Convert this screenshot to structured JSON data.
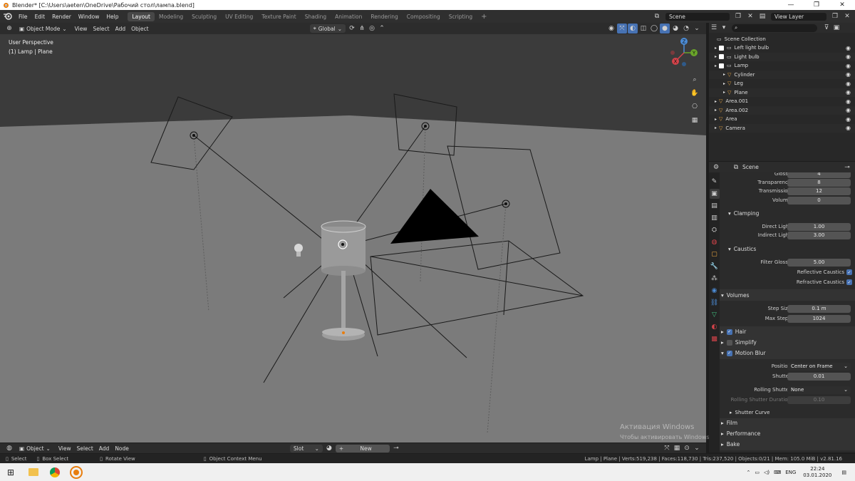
{
  "window": {
    "title": "Blender* [C:\\Users\\aeten\\OneDrive\\Рабочий стол\\лампа.blend]",
    "minimize": "—",
    "maximize": "❐",
    "close": "✕"
  },
  "menu": [
    "File",
    "Edit",
    "Render",
    "Window",
    "Help"
  ],
  "workspaces": [
    {
      "label": "Layout",
      "active": true
    },
    {
      "label": "Modeling",
      "active": false
    },
    {
      "label": "Sculpting",
      "active": false
    },
    {
      "label": "UV Editing",
      "active": false
    },
    {
      "label": "Texture Paint",
      "active": false
    },
    {
      "label": "Shading",
      "active": false
    },
    {
      "label": "Animation",
      "active": false
    },
    {
      "label": "Rendering",
      "active": false
    },
    {
      "label": "Compositing",
      "active": false
    },
    {
      "label": "Scripting",
      "active": false
    }
  ],
  "add_workspace": "+",
  "scene_field": "Scene",
  "view_layer_field": "View Layer",
  "viewport_header": {
    "mode": "Object Mode",
    "items": [
      "View",
      "Select",
      "Add",
      "Object"
    ],
    "transform_orientation": "Global"
  },
  "viewport": {
    "perspective": "User Perspective",
    "context": "(1) Lamp | Plane"
  },
  "gizmo": {
    "x": "X",
    "y": "Y",
    "z": "Z"
  },
  "outliner": {
    "root": "Scene Collection",
    "items": [
      {
        "label": "Left light bulb",
        "indent": 1,
        "checkbox": true
      },
      {
        "label": "Light bulb",
        "indent": 1,
        "checkbox": true
      },
      {
        "label": "Lamp",
        "indent": 1,
        "checkbox": true
      },
      {
        "label": "Cylinder",
        "indent": 2,
        "checkbox": false
      },
      {
        "label": "Leg",
        "indent": 2,
        "checkbox": false
      },
      {
        "label": "Plane",
        "indent": 2,
        "checkbox": false
      },
      {
        "label": "Area.001",
        "indent": 1,
        "checkbox": false
      },
      {
        "label": "Area.002",
        "indent": 1,
        "checkbox": false
      },
      {
        "label": "Area",
        "indent": 1,
        "checkbox": false
      },
      {
        "label": "Camera",
        "indent": 1,
        "checkbox": false
      }
    ]
  },
  "properties": {
    "context": "Scene",
    "rows": [
      {
        "label": "Glossy",
        "value": "4"
      },
      {
        "label": "Transparency",
        "value": "8"
      },
      {
        "label": "Transmission",
        "value": "12"
      },
      {
        "label": "Volume",
        "value": "0"
      }
    ],
    "clamping": {
      "title": "Clamping",
      "rows": [
        {
          "label": "Direct Light",
          "value": "1.00"
        },
        {
          "label": "Indirect Light",
          "value": "3.00"
        }
      ]
    },
    "caustics": {
      "title": "Caustics",
      "filter_glossy_label": "Filter Glossy",
      "filter_glossy": "5.00",
      "reflective": "Reflective Caustics",
      "refractive": "Refractive Caustics"
    },
    "volumes": {
      "title": "Volumes",
      "rows": [
        {
          "label": "Step Size",
          "value": "0.1 m"
        },
        {
          "label": "Max Steps",
          "value": "1024"
        }
      ]
    },
    "hair": "Hair",
    "simplify": "Simplify",
    "motion_blur": {
      "title": "Motion Blur",
      "position_label": "Position",
      "position": "Center on Frame",
      "shutter_label": "Shutter",
      "shutter": "0.01",
      "rolling_label": "Rolling Shutter",
      "rolling": "None",
      "rolling_dur_label": "Rolling Shutter Duration",
      "rolling_dur": "0.10",
      "shutter_curve": "Shutter Curve"
    },
    "film": "Film",
    "performance": "Performance",
    "bake": "Bake"
  },
  "timeline": {
    "mode": "Object",
    "items": [
      "View",
      "Select",
      "Add",
      "Node"
    ],
    "slot": "Slot",
    "new": "New"
  },
  "status": {
    "select": "Select",
    "box_select": "Box Select",
    "rotate_view": "Rotate View",
    "context_menu": "Object Context Menu",
    "stats": "Lamp | Plane | Verts:519,238 | Faces:118,730 | Tris:237,520 | Objects:0/21 | Mem: 105.0 MiB | v2.81.16"
  },
  "watermark": {
    "line1": "Активация Windows",
    "line2": "Чтобы активировать Windows, перейдите в раздел \"Параметры\"."
  },
  "taskbar": {
    "lang": "ENG",
    "time": "22:24",
    "date": "03.01.2020"
  },
  "colors": {
    "accent": "#4772b3",
    "active_tab": "#474747",
    "outliner_selected": "#334d80",
    "object_orange": "#e8a440",
    "mesh_green": "#40c080"
  }
}
